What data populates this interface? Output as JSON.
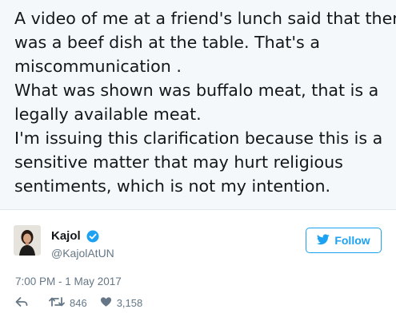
{
  "tweet": {
    "lines": [
      "A video of me at a friend's lunch said that there",
      "was a beef dish at the table. That's a",
      "miscommunication .",
      "What was shown was buffalo meat, that is a",
      "legally available meat.",
      "I'm issuing this clarification because this is a",
      "sensitive matter that may hurt religious",
      "sentiments, which is not my intention."
    ],
    "timestamp": "7:00 PM - 1 May 2017"
  },
  "author": {
    "name": "Kajol",
    "handle": "@KajolAtUN",
    "verified": true
  },
  "follow_button": {
    "label": "Follow",
    "icon": "twitter-bird-icon"
  },
  "actions": {
    "reply_icon": "reply-icon",
    "retweet_icon": "retweet-icon",
    "retweet_count": "846",
    "like_icon": "heart-icon",
    "like_count": "3,158"
  },
  "colors": {
    "text_background": "#f5f8fa",
    "accent": "#1da1f2",
    "secondary_text": "#657786",
    "primary_text": "#14171a"
  }
}
